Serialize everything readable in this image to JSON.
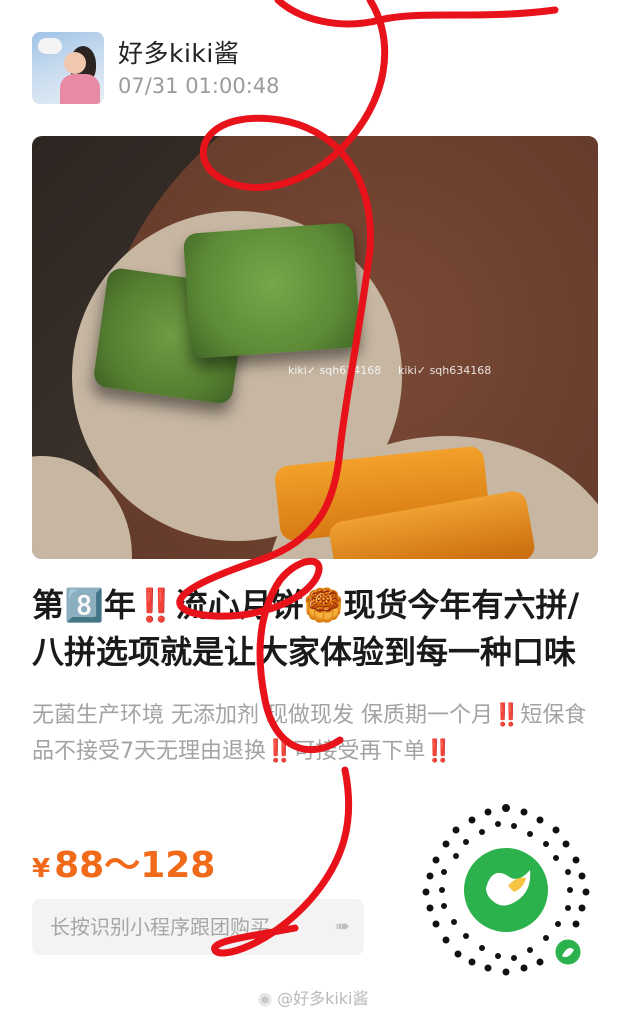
{
  "post": {
    "username": "好多kiki酱",
    "timestamp": "07/31 01:00:48",
    "image_watermark_1": "kiki✓ sqh634168",
    "image_watermark_2": "kiki✓ sqh634168",
    "title": "第8️⃣年‼️流心月饼🥮现货今年有六拼/八拼选项就是让大家体验到每一种口味",
    "description": "无菌生产环境 无添加剂 现做现发 保质期一个月‼️短保食品不接受7天无理由退换‼️可接受再下单‼️",
    "price_currency": "¥",
    "price_range": "88～128",
    "cta_label": "长按识别小程序跟团购买",
    "footer_watermark": "@好多kiki酱"
  },
  "colors": {
    "price": "#f06a1a",
    "mini_program_green": "#2bb24c",
    "annotation_red": "#e8121b"
  },
  "icons": {
    "cta_arrow": "hand-pointing-icon",
    "qr": "mini-program-qr-code",
    "footer": "weibo-logo-icon"
  }
}
